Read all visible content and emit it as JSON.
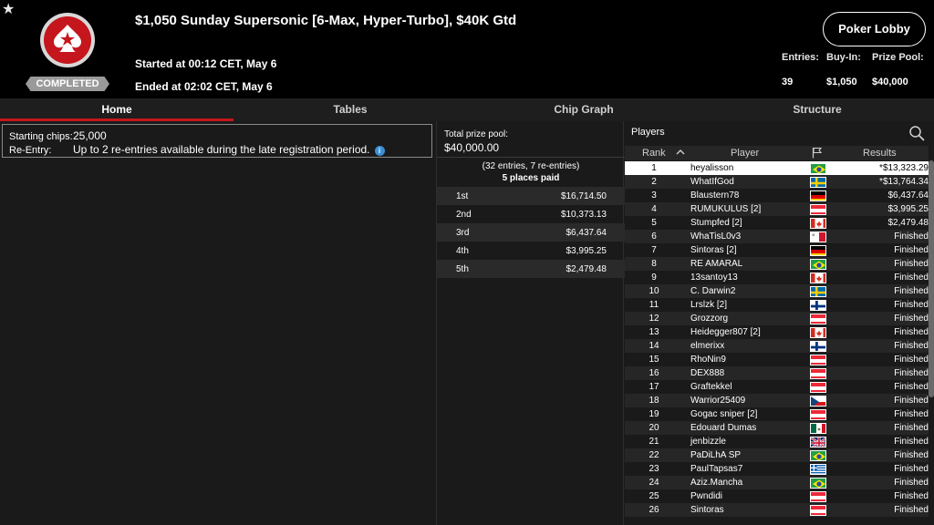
{
  "header": {
    "title": "$1,050 Sunday Supersonic [6-Max, Hyper-Turbo], $40K Gtd",
    "started": "Started at 00:12 CET, May 6",
    "ended": "Ended at 02:02 CET, May 6",
    "status_badge": "COMPLETED",
    "lobby_button": "Poker Lobby",
    "stats": {
      "entries_label": "Entries:",
      "entries_value": "39",
      "buyin_label": "Buy-In:",
      "buyin_value": "$1,050",
      "prizepool_label": "Prize Pool:",
      "prizepool_value": "$40,000"
    }
  },
  "tabs": [
    {
      "label": "Home"
    },
    {
      "label": "Tables"
    },
    {
      "label": "Chip Graph"
    },
    {
      "label": "Structure"
    }
  ],
  "info": {
    "starting_chips_label": "Starting chips:",
    "starting_chips_value": "25,000",
    "reentry_label": "Re-Entry:",
    "reentry_value": "Up to 2 re-entries available during the late registration period."
  },
  "prize": {
    "total_label": "Total prize pool:",
    "total_value": "$40,000.00",
    "entries_note": "(32 entries, 7 re-entries)",
    "places_paid": "5 places paid",
    "places": [
      {
        "place": "1st",
        "amount": "$16,714.50"
      },
      {
        "place": "2nd",
        "amount": "$10,373.13"
      },
      {
        "place": "3rd",
        "amount": "$6,437.64"
      },
      {
        "place": "4th",
        "amount": "$3,995.25"
      },
      {
        "place": "5th",
        "amount": "$2,479.48"
      }
    ]
  },
  "players": {
    "title": "Players",
    "columns": {
      "rank": "Rank",
      "player": "Player",
      "results": "Results"
    },
    "rows": [
      {
        "rank": "1",
        "name": "heyalisson",
        "flag": "brazil",
        "result": "*$13,323.29"
      },
      {
        "rank": "2",
        "name": "WhatIfGod",
        "flag": "sweden",
        "result": "*$13,764.34"
      },
      {
        "rank": "3",
        "name": "Blaustern78",
        "flag": "germany",
        "result": "$6,437.64"
      },
      {
        "rank": "4",
        "name": "RUMUKULUS [2]",
        "flag": "austria",
        "result": "$3,995.25"
      },
      {
        "rank": "5",
        "name": "Stumpfed [2]",
        "flag": "canada",
        "result": "$2,479.48"
      },
      {
        "rank": "6",
        "name": "WhaTisL0v3",
        "flag": "malta",
        "result": "Finished"
      },
      {
        "rank": "7",
        "name": "Sintoras [2]",
        "flag": "germany",
        "result": "Finished"
      },
      {
        "rank": "8",
        "name": "RE AMARAL",
        "flag": "brazil",
        "result": "Finished"
      },
      {
        "rank": "9",
        "name": "13santoy13",
        "flag": "canada",
        "result": "Finished"
      },
      {
        "rank": "10",
        "name": "C. Darwin2",
        "flag": "sweden",
        "result": "Finished"
      },
      {
        "rank": "11",
        "name": "Lrslzk [2]",
        "flag": "finland",
        "result": "Finished"
      },
      {
        "rank": "12",
        "name": "Grozzorg",
        "flag": "austria",
        "result": "Finished"
      },
      {
        "rank": "13",
        "name": "Heidegger807 [2]",
        "flag": "canada",
        "result": "Finished"
      },
      {
        "rank": "14",
        "name": "elmerixx",
        "flag": "finland",
        "result": "Finished"
      },
      {
        "rank": "15",
        "name": "RhoNin9",
        "flag": "austria",
        "result": "Finished"
      },
      {
        "rank": "16",
        "name": "DEX888",
        "flag": "austria",
        "result": "Finished"
      },
      {
        "rank": "17",
        "name": "Graftekkel",
        "flag": "austria",
        "result": "Finished"
      },
      {
        "rank": "18",
        "name": "Warrior25409",
        "flag": "czech",
        "result": "Finished"
      },
      {
        "rank": "19",
        "name": "Gogac sniper [2]",
        "flag": "austria",
        "result": "Finished"
      },
      {
        "rank": "20",
        "name": "Edouard Dumas",
        "flag": "mexico",
        "result": "Finished"
      },
      {
        "rank": "21",
        "name": "jenbizzle",
        "flag": "uk",
        "result": "Finished"
      },
      {
        "rank": "22",
        "name": "PaDiLhA SP",
        "flag": "brazil",
        "result": "Finished"
      },
      {
        "rank": "23",
        "name": "PaulTapsas7",
        "flag": "greece",
        "result": "Finished"
      },
      {
        "rank": "24",
        "name": "Aziz.Mancha",
        "flag": "brazil",
        "result": "Finished"
      },
      {
        "rank": "25",
        "name": "Pwndidi",
        "flag": "austria",
        "result": "Finished"
      },
      {
        "rank": "26",
        "name": "Sintoras",
        "flag": "austria",
        "result": "Finished"
      }
    ]
  },
  "colors": {
    "accent": "#c4161c",
    "background": "#000000",
    "panel": "#1a1a1a"
  }
}
